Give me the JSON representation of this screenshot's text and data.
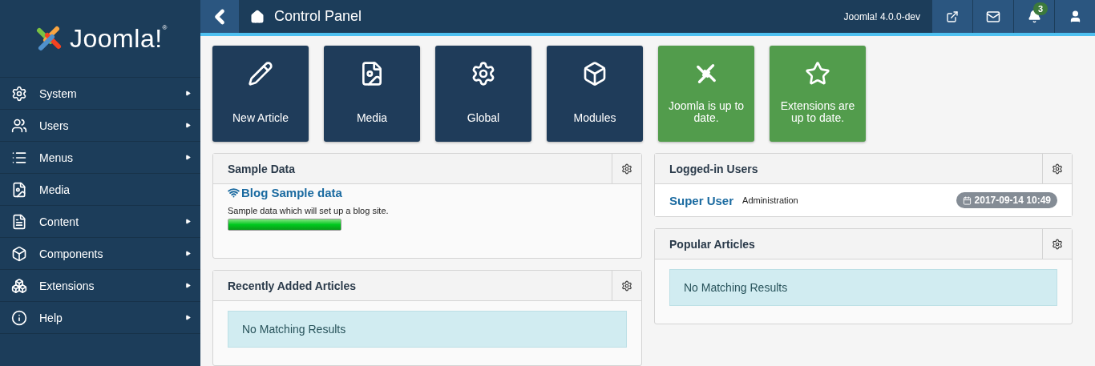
{
  "logo": {
    "text": "Joomla!$^{®}$"
  },
  "sidebar": {
    "items": [
      {
        "label": "System",
        "has_submenu": true
      },
      {
        "label": "Users",
        "has_submenu": true
      },
      {
        "label": "Menus",
        "has_submenu": true
      },
      {
        "label": "Media",
        "has_submenu": false
      },
      {
        "label": "Content",
        "has_submenu": true
      },
      {
        "label": "Components",
        "has_submenu": true
      },
      {
        "label": "Extensions",
        "has_submenu": true
      },
      {
        "label": "Help",
        "has_submenu": true
      }
    ]
  },
  "header": {
    "title": "Control Panel",
    "version": "Joomla! 4.0.0-dev",
    "notifications_badge": "3"
  },
  "quick_icons": [
    {
      "label": "New Article",
      "kind": "action"
    },
    {
      "label": "Media",
      "kind": "action"
    },
    {
      "label": "Global",
      "kind": "action"
    },
    {
      "label": "Modules",
      "kind": "action"
    },
    {
      "label": "Joomla is up to date.",
      "kind": "status"
    },
    {
      "label": "Extensions are up to date.",
      "kind": "status"
    }
  ],
  "sample_data": {
    "title": "Sample Data",
    "item_title": "Blog Sample data",
    "description": "Sample data which will set up a blog site.",
    "level": 1
  },
  "recently_added": {
    "title": "Recently Added Articles",
    "message": "No Matching Results"
  },
  "logged_in": {
    "title": "Logged-in Users",
    "users": [
      {
        "name": "Super User",
        "client": "Administration",
        "date": "2017-09-14 10:49"
      }
    ]
  },
  "popular": {
    "title": "Popular Articles",
    "message": "No Matching Results"
  }
}
